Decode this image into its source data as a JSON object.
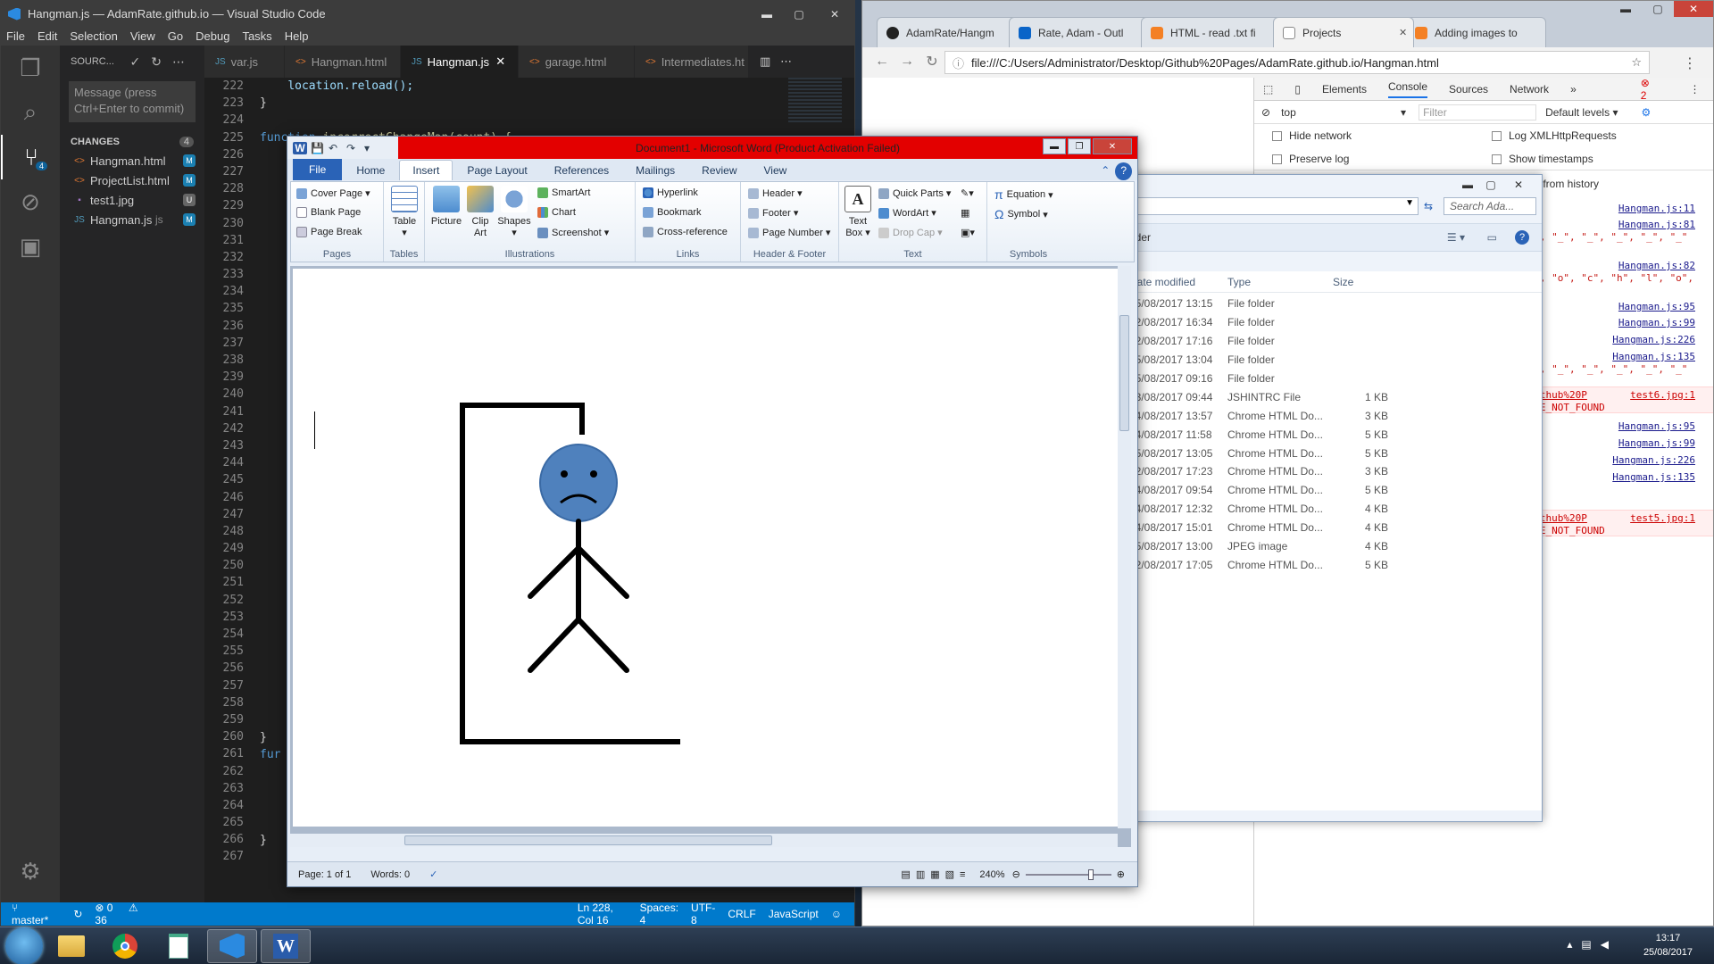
{
  "vscode": {
    "window_title": "Hangman.js — AdamRate.github.io — Visual Studio Code",
    "menu": [
      "File",
      "Edit",
      "Selection",
      "View",
      "Go",
      "Debug",
      "Tasks",
      "Help"
    ],
    "source_control": {
      "header": "SOURC...",
      "message_placeholder": "Message (press Ctrl+Enter to commit)",
      "changes_label": "CHANGES",
      "changes_count": "4",
      "files": [
        {
          "name": "Hangman.html",
          "status": "M"
        },
        {
          "name": "ProjectList.html",
          "status": "M"
        },
        {
          "name": "test1.jpg",
          "status": "U"
        },
        {
          "name": "Hangman.js",
          "extra": "js",
          "status": "M"
        }
      ]
    },
    "activity_badge": "4",
    "tabs": [
      {
        "label": "var.js",
        "kind": "JS"
      },
      {
        "label": "Hangman.html",
        "kind": "<>"
      },
      {
        "label": "Hangman.js",
        "kind": "JS",
        "active": true
      },
      {
        "label": "garage.html",
        "kind": "<>"
      },
      {
        "label": "Intermediates.ht",
        "kind": "<>"
      }
    ],
    "line_numbers": [
      "222",
      "223",
      "224",
      "225",
      "226",
      "227",
      "228",
      "229",
      "230",
      "231",
      "232",
      "233",
      "234",
      "235",
      "236",
      "237",
      "238",
      "239",
      "240",
      "241",
      "242",
      "243",
      "244",
      "245",
      "246",
      "247",
      "248",
      "249",
      "250",
      "251",
      "252",
      "253",
      "254",
      "255",
      "256",
      "257",
      "258",
      "259",
      "260",
      "261",
      "262",
      "263",
      "264",
      "265",
      "266",
      "267"
    ],
    "code": {
      "l222": "location.reload();",
      "l223": "}",
      "l225a": "function",
      "l225b": "incorrectChangeMan(count) {",
      "l259": "}",
      "l260": "fur",
      "l265": "}"
    },
    "status": {
      "branch": "master*",
      "errors": "0",
      "warnings": "36",
      "position": "Ln 228, Col 16",
      "spaces": "Spaces: 4",
      "encoding": "UTF-8",
      "eol": "CRLF",
      "language": "JavaScript"
    }
  },
  "chrome": {
    "tabs": [
      "AdamRate/Hangm",
      "Rate, Adam - Outl",
      "HTML - read .txt fi",
      "Projects",
      "Adding images to"
    ],
    "url": "file:///C:/Users/Administrator/Desktop/Github%20Pages/AdamRate.github.io/Hangman.html",
    "devtools": {
      "tabs": [
        "Elements",
        "Console",
        "Sources",
        "Network"
      ],
      "error_count": "2",
      "context": "top",
      "filter_placeholder": "Filter",
      "levels": "Default levels",
      "options": [
        "Hide network",
        "Log XMLHttpRequests",
        "Preserve log",
        "Show timestamps"
      ],
      "autocomplete": "mplete from history",
      "log_links": [
        "Hangman.js:11",
        "Hangman.js:81",
        "Hangman.js:82",
        "Hangman.js:95",
        "Hangman.js:99",
        "Hangman.js:226",
        "Hangman.js:135",
        "Hangman.js:95",
        "Hangman.js:99",
        "Hangman.js:226",
        "Hangman.js:135"
      ],
      "arr1": "\"_\", \"_\", \"_\", \"_\", \"_\", \"_\"",
      "arr2": "\"r\", \"o\", \"c\", \"h\", \"l\", \"o\",",
      "arr3": "\"_\", \"_\", \"_\", \"_\", \"_\", \"_\"",
      "err1_path": "/Github%20P",
      "err1_file": "test6.jpg:1",
      "err2_path": "/Github%20P",
      "err2_file": "test5.jpg:1",
      "err_text": "FILE_NOT_FOUND"
    }
  },
  "explorer": {
    "search_placeholder": "Search Ada...",
    "folder_label": "folder",
    "columns": [
      "Date modified",
      "Type",
      "Size"
    ],
    "rows": [
      {
        "date": "25/08/2017 13:15",
        "type": "File folder",
        "size": ""
      },
      {
        "date": "22/08/2017 16:34",
        "type": "File folder",
        "size": ""
      },
      {
        "date": "22/08/2017 17:16",
        "type": "File folder",
        "size": ""
      },
      {
        "date": "25/08/2017 13:04",
        "type": "File folder",
        "size": ""
      },
      {
        "date": "25/08/2017 09:16",
        "type": "File folder",
        "size": ""
      },
      {
        "date": "23/08/2017 09:44",
        "type": "JSHINTRC File",
        "size": "1 KB"
      },
      {
        "date": "24/08/2017 13:57",
        "type": "Chrome HTML Do...",
        "size": "3 KB"
      },
      {
        "date": "24/08/2017 11:58",
        "type": "Chrome HTML Do...",
        "size": "5 KB"
      },
      {
        "date": "25/08/2017 13:05",
        "type": "Chrome HTML Do...",
        "size": "5 KB"
      },
      {
        "date": "22/08/2017 17:23",
        "type": "Chrome HTML Do...",
        "size": "3 KB"
      },
      {
        "date": "24/08/2017 09:54",
        "type": "Chrome HTML Do...",
        "size": "5 KB"
      },
      {
        "date": "24/08/2017 12:32",
        "type": "Chrome HTML Do...",
        "size": "4 KB"
      },
      {
        "date": "24/08/2017 15:01",
        "type": "Chrome HTML Do...",
        "size": "4 KB"
      },
      {
        "date": "25/08/2017 13:00",
        "type": "JPEG image",
        "size": "4 KB"
      },
      {
        "date": "22/08/2017 17:05",
        "type": "Chrome HTML Do...",
        "size": "5 KB"
      }
    ]
  },
  "word": {
    "title": "Document1 - Microsoft Word (Product Activation Failed)",
    "tabs": [
      "File",
      "Home",
      "Insert",
      "Page Layout",
      "References",
      "Mailings",
      "Review",
      "View"
    ],
    "groups": {
      "pages": {
        "label": "Pages",
        "items": [
          "Cover Page",
          "Blank Page",
          "Page Break"
        ]
      },
      "tables": {
        "label": "Tables",
        "table": "Table"
      },
      "illustrations": {
        "label": "Illustrations",
        "picture": "Picture",
        "clipart1": "Clip",
        "clipart2": "Art",
        "shapes": "Shapes",
        "items": [
          "SmartArt",
          "Chart",
          "Screenshot"
        ]
      },
      "links": {
        "label": "Links",
        "items": [
          "Hyperlink",
          "Bookmark",
          "Cross-reference"
        ]
      },
      "header_footer": {
        "label": "Header & Footer",
        "items": [
          "Header",
          "Footer",
          "Page Number"
        ]
      },
      "text": {
        "label": "Text",
        "textbox1": "Text",
        "textbox2": "Box",
        "items": [
          "Quick Parts",
          "WordArt",
          "Drop Cap"
        ]
      },
      "symbols": {
        "label": "Symbols",
        "items": [
          "Equation",
          "Symbol"
        ]
      }
    },
    "status": {
      "page": "Page: 1 of 1",
      "words": "Words: 0",
      "zoom": "240%"
    }
  },
  "taskbar": {
    "time": "13:17",
    "date": "25/08/2017"
  }
}
